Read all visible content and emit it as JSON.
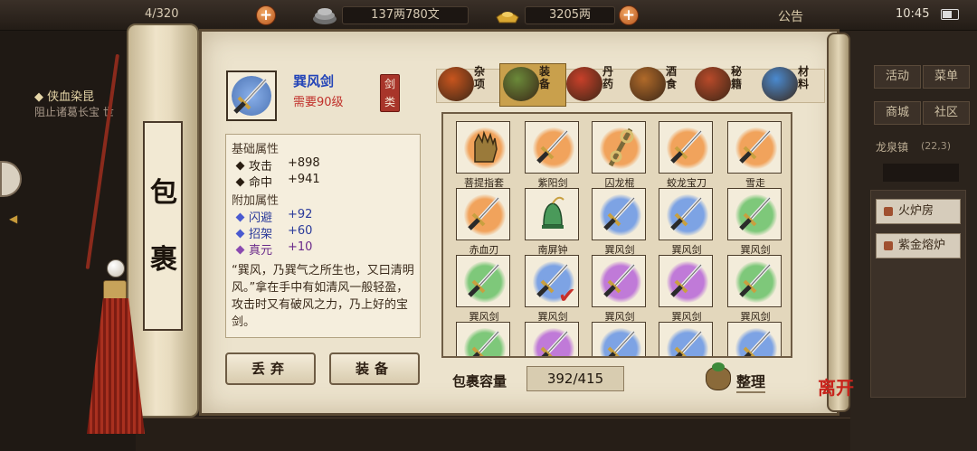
{
  "status_bar": {
    "resource_partial": "4/320",
    "money": "137两780文",
    "gold": "3205两",
    "notice_label": "公告",
    "time": "10:45"
  },
  "quest": {
    "title": "◆ 侠血染昆",
    "desc": "阻止诸葛长宝 世"
  },
  "right_menu": {
    "buttons": [
      "活动",
      "菜单",
      "商城",
      "社区"
    ],
    "town": "龙泉镇",
    "coord": "(22,3)",
    "town_tab": "",
    "list": [
      "火炉房",
      "紫金熔炉"
    ]
  },
  "scroll": {
    "title_chars": [
      "包",
      "裹"
    ]
  },
  "item": {
    "name": "巽风剑",
    "requirement": "需要90级",
    "category_stamp": "剑类",
    "base_header": "基础属性",
    "base_attrs": [
      {
        "name": "攻击",
        "value": "+898"
      },
      {
        "name": "命中",
        "value": "+941"
      }
    ],
    "extra_header": "附加属性",
    "extra_attrs": [
      {
        "name": "闪避",
        "value": "+92"
      },
      {
        "name": "招架",
        "value": "+60"
      },
      {
        "name": "真元",
        "value": "+10"
      }
    ],
    "description": "“巽风，乃巽气之所生也，又曰清明风。”拿在手中有如清风一般轻盈，攻击时又有破风之力，乃上好的宝剑。"
  },
  "actions": {
    "discard": "丢弃",
    "equip": "装备"
  },
  "tabs": [
    {
      "label": "杂项",
      "color": "#c8551e",
      "active": false
    },
    {
      "label": "装备",
      "color": "#6b8a3a",
      "active": true
    },
    {
      "label": "丹药",
      "color": "#c8402a",
      "active": false
    },
    {
      "label": "酒食",
      "color": "#b06a2a",
      "active": false
    },
    {
      "label": "秘籍",
      "color": "#b84a2a",
      "active": false
    },
    {
      "label": "材料",
      "color": "#4a8ad0",
      "active": false
    }
  ],
  "inventory": [
    {
      "name": "菩提指套",
      "color": "#f1a35c",
      "icon": "glove"
    },
    {
      "name": "紫阳剑",
      "color": "#f1a35c",
      "icon": "sword"
    },
    {
      "name": "囚龙棍",
      "color": "#f1a35c",
      "icon": "staff"
    },
    {
      "name": "蛟龙宝刀",
      "color": "#f1a35c",
      "icon": "sword"
    },
    {
      "name": "雪走",
      "color": "#f1a35c",
      "icon": "sword"
    },
    {
      "name": "赤血刃",
      "color": "#f1a35c",
      "icon": "sword"
    },
    {
      "name": "南屏钟",
      "color": "#f3ecda",
      "icon": "bell"
    },
    {
      "name": "巽风剑",
      "color": "#7da3e4",
      "icon": "sword"
    },
    {
      "name": "巽风剑",
      "color": "#7da3e4",
      "icon": "sword"
    },
    {
      "name": "巽风剑",
      "color": "#7ec87a",
      "icon": "sword"
    },
    {
      "name": "巽风剑",
      "color": "#7ec87a",
      "icon": "sword"
    },
    {
      "name": "巽风剑",
      "color": "#7da3e4",
      "icon": "sword",
      "selected": true
    },
    {
      "name": "巽风剑",
      "color": "#c07ad8",
      "icon": "sword"
    },
    {
      "name": "巽风剑",
      "color": "#c07ad8",
      "icon": "sword"
    },
    {
      "name": "巽风剑",
      "color": "#7ec87a",
      "icon": "sword"
    },
    {
      "name": "",
      "color": "#7ec87a",
      "icon": "sword"
    },
    {
      "name": "",
      "color": "#c07ad8",
      "icon": "sword"
    },
    {
      "name": "",
      "color": "#7da3e4",
      "icon": "sword"
    },
    {
      "name": "",
      "color": "#7da3e4",
      "icon": "sword"
    },
    {
      "name": "",
      "color": "#7da3e4",
      "icon": "sword"
    }
  ],
  "capacity": {
    "label": "包裹容量",
    "value": "392/415"
  },
  "sort_label": "整理",
  "close_label": "离开"
}
